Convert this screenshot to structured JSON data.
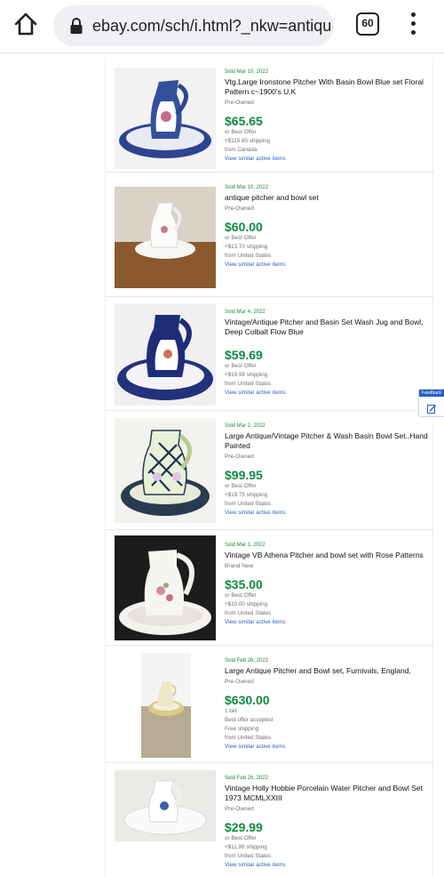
{
  "browser": {
    "url": "ebay.com/sch/i.html?_nkw=antique",
    "tab_count": "60"
  },
  "feedback": {
    "label": "Feedback"
  },
  "items": [
    {
      "sold": "Sold Mar 10, 2022",
      "title": "Vtg.Large Ironstone Pitcher With Basin Bowl Blue set Floral Pattern c~1900's U.K",
      "condition": "Pre-Owned",
      "price": "$65.65",
      "line1": "or Best Offer",
      "line2": "+$115.85 shipping",
      "line3": "from Canada",
      "line4": "",
      "similar": "View similar active items"
    },
    {
      "sold": "Sold Mar 10, 2022",
      "title": "antique pitcher and bowl set",
      "condition": "Pre-Owned",
      "price": "$60.00",
      "line1": "or Best Offer",
      "line2": "+$13.70 shipping",
      "line3": "from United States",
      "line4": "",
      "similar": "View similar active items"
    },
    {
      "sold": "Sold Mar 4, 2022",
      "title": "Vintage/Antique Pitcher and Basin Set Wash Jug and Bowl, Deep Colbalt Flow Blue",
      "condition": "",
      "price": "$59.69",
      "line1": "or Best Offer",
      "line2": "+$19.99 shipping",
      "line3": "from United States",
      "line4": "",
      "similar": "View similar active items"
    },
    {
      "sold": "Sold Mar 2, 2022",
      "title": "Large Antique/Vintage Pitcher & Wash Basin Bowl Set..Hand Painted",
      "condition": "Pre-Owned",
      "price": "$99.95",
      "line1": "or Best Offer",
      "line2": "+$19.75 shipping",
      "line3": "from United States",
      "line4": "",
      "similar": "View similar active items"
    },
    {
      "sold": "Sold Mar 1, 2022",
      "title": "Vintage VB Athena Pitcher and bowl set with Rose Patterns",
      "condition": "Brand New",
      "price": "$35.00",
      "line1": "or Best Offer",
      "line2": "+$10.00 shipping",
      "line3": "from United States",
      "line4": "",
      "similar": "View similar active items"
    },
    {
      "sold": "Sold Feb 26, 2022",
      "title": "Large Antique Pitcher and Bowl set, Furnivals, England,",
      "condition": "Pre-Owned",
      "price": "$630.00",
      "line1": "1 bid",
      "line2": "Best offer accepted",
      "line3": "Free shipping",
      "line4": "from United States",
      "similar": "View similar active items"
    },
    {
      "sold": "Sold Feb 26, 2022",
      "title": "Vintage Holly Hobbie Porcelain Water Pitcher and Bowl Set 1973 MCMLXXIII",
      "condition": "Pre-Owned",
      "price": "$29.99",
      "line1": "or Best Offer",
      "line2": "+$11.99 shipping",
      "line3": "from United States",
      "line4": "",
      "similar": "View similar active items"
    }
  ]
}
